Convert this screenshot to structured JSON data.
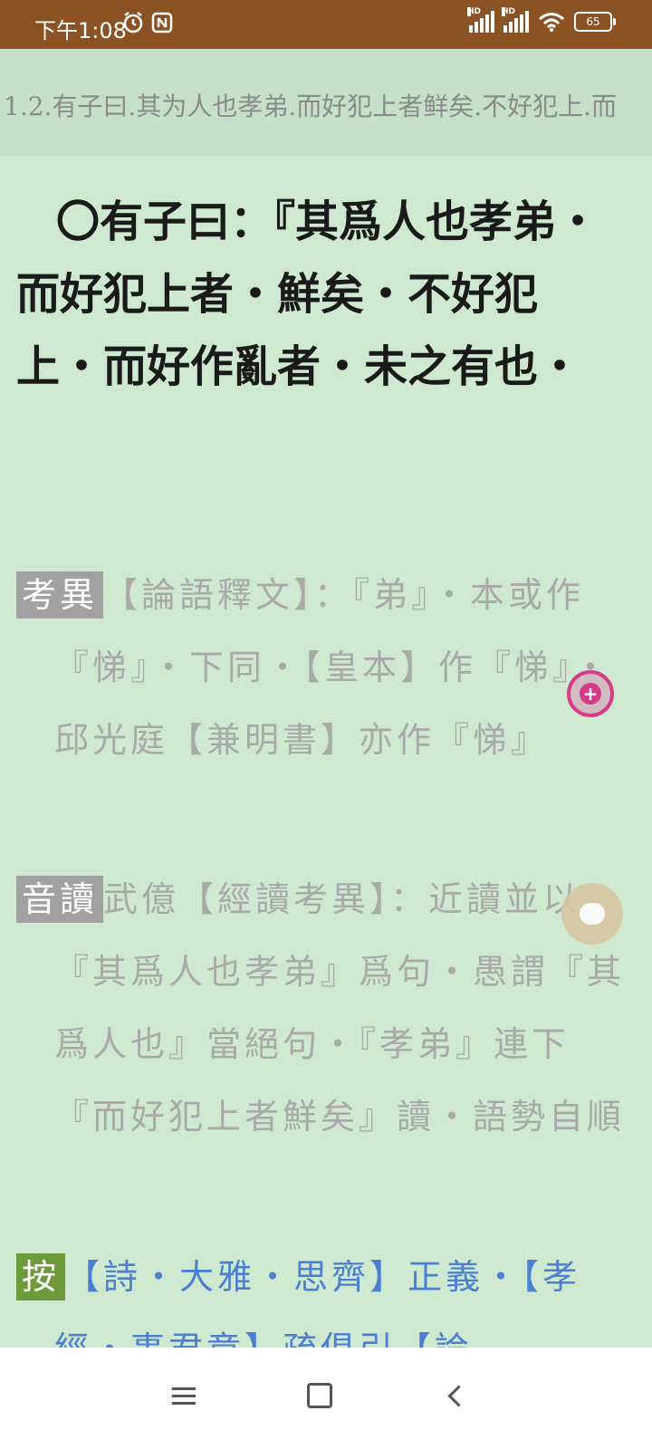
{
  "status": {
    "time": "下午1:08",
    "battery": "65",
    "network_label": "HD"
  },
  "header": {
    "title": "1.2.有子曰.其为人也孝弟.而好犯上者鲜矣.不好犯上.而"
  },
  "verse": {
    "text": "〇有子曰：『其爲人也孝弟・而好犯上者・鮮矣・不好犯上・而好作亂者・未之有也・"
  },
  "blocks": [
    {
      "tag": "考異",
      "text": "【論語釋文】：『弟』・本或作『悌』・下同・【皇本】作『悌』・邱光庭【兼明書】亦作『悌』"
    },
    {
      "tag": "音讀",
      "text": "武億【經讀考異】：近讀並以『其爲人也孝弟』爲句・愚謂『其爲人也』當絕句・『孝弟』連下『而好犯上者鮮矣』讀・語勢自順"
    },
    {
      "tag": "按",
      "text": "【詩・大雅・思齊】正義・【孝經・事君章】疏俱引【論"
    }
  ],
  "colors": {
    "background": "#cfe8d0",
    "status_bar": "#8b5224",
    "tag_gray": "#a1a1a1",
    "tag_green": "#6e9a3b",
    "link_blue": "#4a7fd2",
    "fab_pink": "#d63a8a"
  }
}
